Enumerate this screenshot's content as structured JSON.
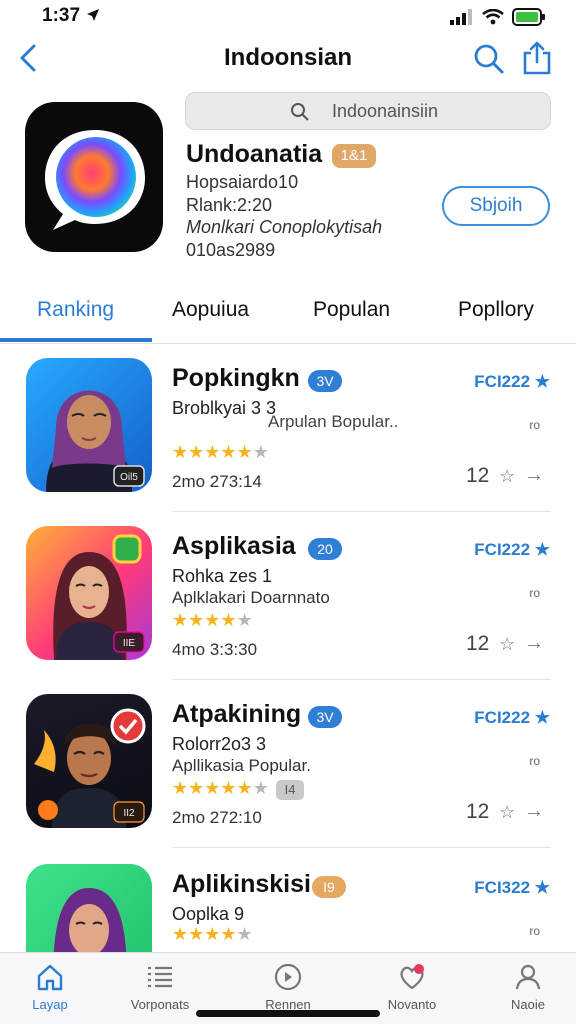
{
  "status_bar": {
    "time": "1:37"
  },
  "nav": {
    "title": "Indoonsian"
  },
  "search": {
    "placeholder": "Indoonainsiin"
  },
  "app": {
    "name": "Undoanatia",
    "badge": "1&1",
    "meta_line1": "Hopsaiardo10",
    "meta_line2": "Rlank:2:20",
    "meta_line3": "Monlkari Conoplokytisah",
    "meta_line4": "010as2989",
    "get_label": "Sbjoih"
  },
  "tabs": [
    "Ranking",
    "Aopuiua",
    "Populan",
    "Popllory"
  ],
  "list": [
    {
      "title": "Popkingkn",
      "pill": "3V",
      "sub1": "Broblkyai 3 3",
      "sub2": "",
      "extra": "Arpulan Bopular..",
      "stars": 4,
      "date": "2mo 273:14",
      "price": "FCI222 ★",
      "small": "ro",
      "count": "12",
      "thumb_badge": "Oil5"
    },
    {
      "title": "Asplikasia",
      "pill": "20",
      "sub1": "Rohka zes 1",
      "sub2": "Aplklakari Doarnnato",
      "extra": "",
      "stars": 4,
      "date": "4mo 3:3:30",
      "price": "FCI222 ★",
      "small": "ro",
      "count": "12",
      "thumb_badge": "IIE"
    },
    {
      "title": "Atpakining",
      "pill": "3V",
      "sub1": "Rolorr2o3 3",
      "sub2": "Apllikasia Popular.",
      "extra": "",
      "stars": 4,
      "chip": "I4",
      "date": "2mo 272:10",
      "price": "FCI222 ★",
      "small": "ro",
      "count": "12",
      "thumb_badge": "II2"
    },
    {
      "title": "Aplikinskisi",
      "pill": "I9",
      "sub1": "Ooplka 9",
      "sub2": "",
      "extra": "",
      "stars": 4,
      "date": "",
      "price": "FCI322 ★",
      "small": "ro",
      "count": "",
      "thumb_badge": ""
    }
  ],
  "tab_bar": [
    {
      "label": "Layap",
      "icon": "home-icon"
    },
    {
      "label": "Vorponats",
      "icon": "list-icon"
    },
    {
      "label": "Rennen",
      "icon": "discover-icon"
    },
    {
      "label": "Novanto",
      "icon": "heart-icon"
    },
    {
      "label": "Naoie",
      "icon": "profile-icon"
    }
  ],
  "colors": {
    "accent": "#2a7cd3",
    "star": "#f5b21d",
    "pill_blue": "#2f7fd6",
    "pill_orange": "#e6a760"
  }
}
